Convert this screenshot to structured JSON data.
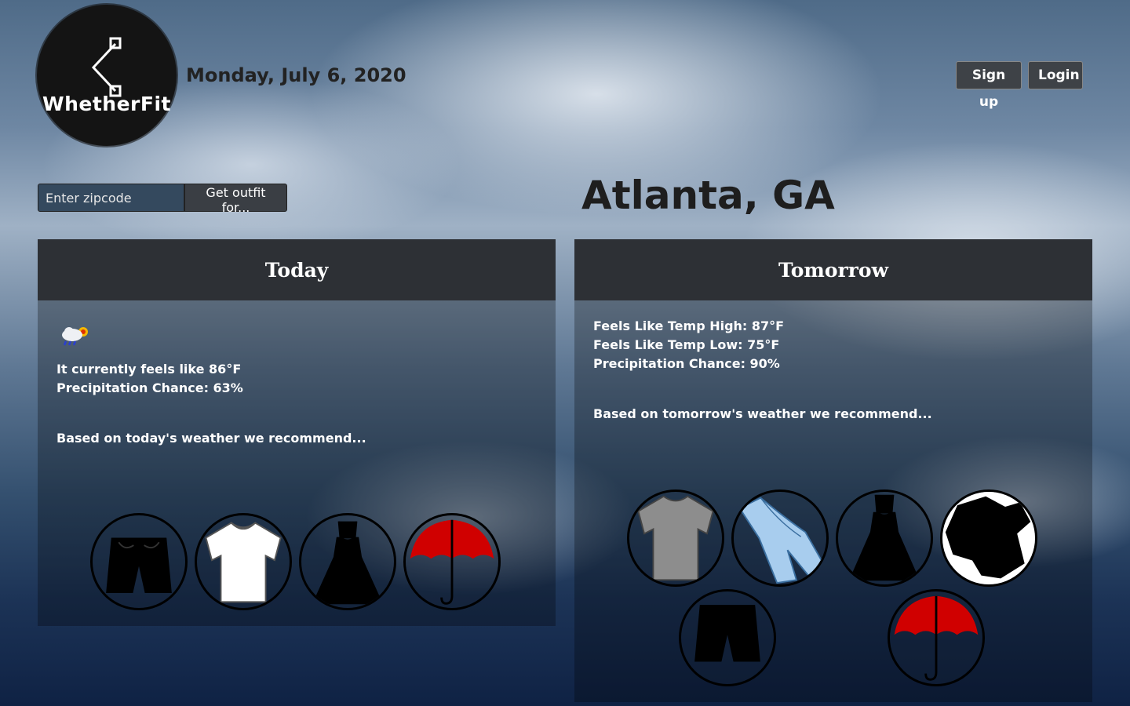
{
  "brand": {
    "name": "WhetherFit"
  },
  "header": {
    "date": "Monday, July 6, 2020"
  },
  "auth": {
    "signup_label": "Sign up",
    "login_label": "Login"
  },
  "search": {
    "placeholder": "Enter zipcode",
    "value": "",
    "button_label": "Get outfit for..."
  },
  "location": {
    "city": "Atlanta, GA"
  },
  "today": {
    "title": "Today",
    "weather_icon": "rain-sun-icon",
    "feels_like": "It currently feels like 86°F",
    "precip": "Precipitation Chance: 63%",
    "recommend": "Based on today's weather we recommend...",
    "items": [
      "shorts-icon",
      "tshirt-icon",
      "dress-icon",
      "umbrella-icon"
    ]
  },
  "tomorrow": {
    "title": "Tomorrow",
    "high": "Feels Like Temp High: 87°F",
    "low": "Feels Like Temp Low: 75°F",
    "precip": "Precipitation Chance: 90%",
    "recommend": "Based on tomorrow's weather we recommend...",
    "items": [
      "tshirt-gray-icon",
      "jeans-icon",
      "dress-icon",
      "sweater-icon",
      "shorts-icon",
      "umbrella-icon"
    ]
  },
  "colors": {
    "card_header": "#2d3035",
    "button": "#3e4247",
    "umbrella": "#d00000"
  }
}
